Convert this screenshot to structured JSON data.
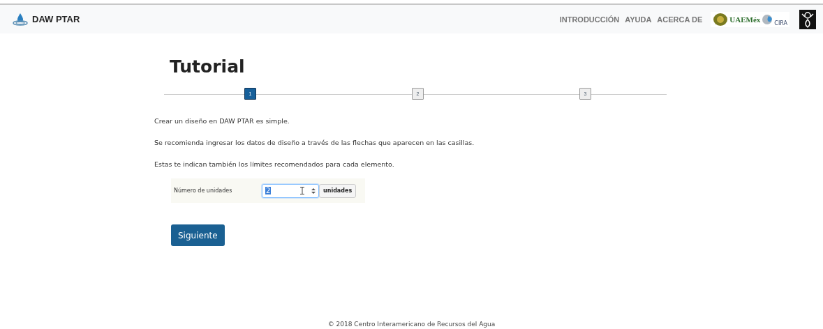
{
  "navbar": {
    "brand": "DAW PTAR",
    "links": [
      "INTRODUCCIÓN",
      "AYUDA",
      "ACERCA DE"
    ],
    "logo_texts": [
      "UAEMéx",
      "CIRA"
    ]
  },
  "title": "Tutorial",
  "steps": [
    {
      "label": "1",
      "selected": true
    },
    {
      "label": "2",
      "selected": false
    },
    {
      "label": "3",
      "selected": false
    }
  ],
  "paragraphs": [
    "Crear un diseño en DAW PTAR es simple.",
    "Se recomienda ingresar los datos de diseño a través de las flechas que aparecen en las casillas.",
    "Estas te indican también los límites recomendados para cada elemento."
  ],
  "form": {
    "label": "Número de unidades",
    "value": "2",
    "unit": "unidades"
  },
  "button": "Siguiente",
  "footer": "© 2018 Centro Interamericano de Recursos del Agua"
}
